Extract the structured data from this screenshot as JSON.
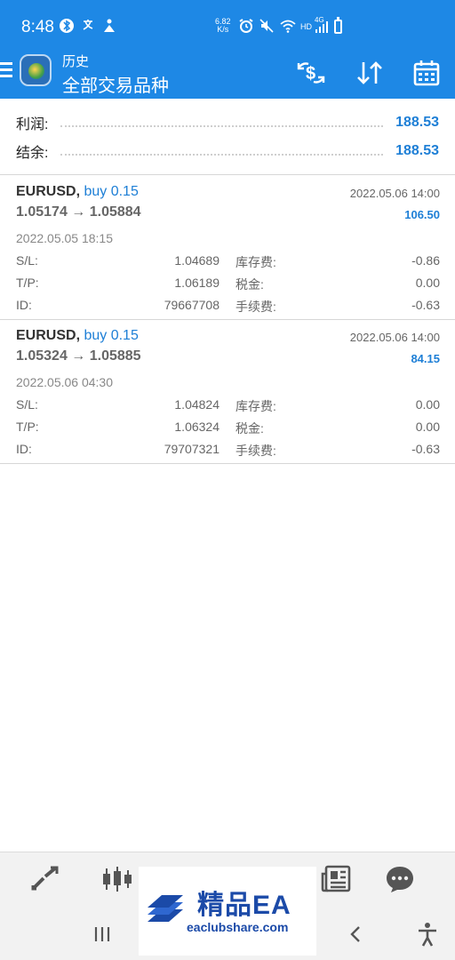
{
  "status_bar": {
    "time": "8:48",
    "net_speed_top": "6.82",
    "net_speed_bottom": "K/s",
    "hd_label": "HD",
    "network": "4G"
  },
  "app_bar": {
    "title": "历史",
    "subtitle": "全部交易品种"
  },
  "summary": {
    "profit_label": "利润:",
    "profit_value": "188.53",
    "balance_label": "结余:",
    "balance_value": "188.53"
  },
  "trades": [
    {
      "symbol": "EURUSD,",
      "side": "buy 0.15",
      "close_time": "2022.05.06 14:00",
      "prices": "1.05174 → 1.05884",
      "profit": "106.50",
      "open_time": "2022.05.05 18:15",
      "sl_label": "S/L:",
      "sl_value": "1.04689",
      "swap_label": "库存费:",
      "swap_value": "-0.86",
      "tp_label": "T/P:",
      "tp_value": "1.06189",
      "tax_label": "税金:",
      "tax_value": "0.00",
      "id_label": "ID:",
      "id_value": "79667708",
      "commission_label": "手续费:",
      "commission_value": "-0.63"
    },
    {
      "symbol": "EURUSD,",
      "side": "buy 0.15",
      "close_time": "2022.05.06 14:00",
      "prices": "1.05324 → 1.05885",
      "profit": "84.15",
      "open_time": "2022.05.06 04:30",
      "sl_label": "S/L:",
      "sl_value": "1.04824",
      "swap_label": "库存费:",
      "swap_value": "0.00",
      "tp_label": "T/P:",
      "tp_value": "1.06324",
      "tax_label": "税金:",
      "tax_value": "0.00",
      "id_label": "ID:",
      "id_value": "79707321",
      "commission_label": "手续费:",
      "commission_value": "-0.63"
    }
  ],
  "watermark": {
    "brand": "精品EA",
    "site": "eaclubshare.com"
  },
  "colors": {
    "accent": "#1e88e5",
    "value_blue": "#1e7fd6"
  },
  "icons": {
    "app_bar": [
      "currency-swap-icon",
      "sort-icon",
      "calendar-icon"
    ],
    "bottom_nav": [
      "quotes-icon",
      "chart-icon",
      "trade-icon",
      "history-icon",
      "news-icon",
      "chat-icon"
    ],
    "system_nav": [
      "recent-apps-icon",
      "home-icon",
      "back-icon",
      "accessibility-icon"
    ]
  }
}
